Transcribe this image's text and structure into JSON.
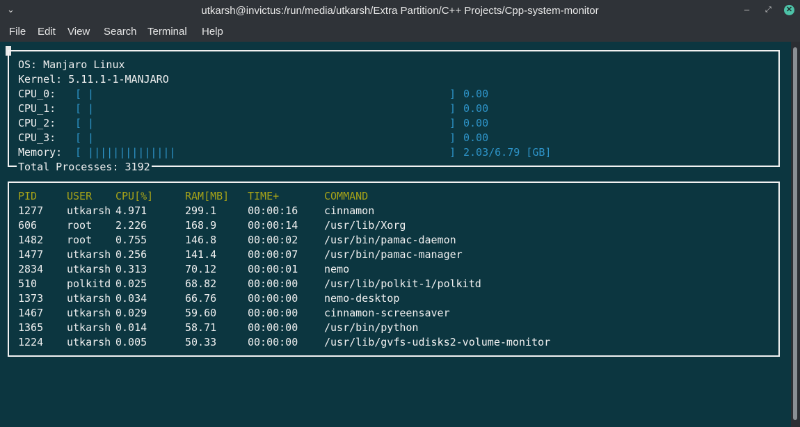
{
  "window": {
    "title": "utkarsh@invictus:/run/media/utkarsh/Extra Partition/C++ Projects/Cpp-system-monitor",
    "menu_icon": "chevron-down-icon",
    "controls": {
      "minimize": "minimize-icon",
      "maximize": "maximize-icon",
      "close": "close-icon"
    },
    "accent": "#4dc3a8"
  },
  "menu": [
    "File",
    "Edit",
    "View",
    "Search",
    "Terminal",
    "Help"
  ],
  "system": {
    "os_label": "OS: ",
    "os": "Manjaro Linux",
    "kernel_label": "Kernel: ",
    "kernel": "5.11.1-1-MANJARO",
    "cpus": [
      {
        "label": "CPU_0:",
        "bar": "[ |",
        "close": "]",
        "value": "0.00",
        "utilization": 0.0
      },
      {
        "label": "CPU_1:",
        "bar": "[ |",
        "close": "]",
        "value": "0.00",
        "utilization": 0.0
      },
      {
        "label": "CPU_2:",
        "bar": "[ |",
        "close": "]",
        "value": "0.00",
        "utilization": 0.0
      },
      {
        "label": "CPU_3:",
        "bar": "[ |",
        "close": "]",
        "value": "0.00",
        "utilization": 0.0
      }
    ],
    "memory": {
      "label": "Memory:",
      "bar": "[ ||||||||||||||",
      "close": "]",
      "value": "2.03/6.79 [GB]",
      "used_gb": 2.03,
      "total_gb": 6.79
    },
    "total_processes_label": "Total Processes: ",
    "total_processes": "3192"
  },
  "processes": {
    "headers": [
      "PID",
      "USER",
      "CPU[%]",
      "RAM[MB]",
      "TIME+",
      "COMMAND"
    ],
    "rows": [
      [
        "1277",
        "utkarsh",
        "4.971",
        "299.1",
        "00:00:16",
        "cinnamon"
      ],
      [
        "606",
        "root",
        "2.226",
        "168.9",
        "00:00:14",
        "/usr/lib/Xorg"
      ],
      [
        "1482",
        "root",
        "0.755",
        "146.8",
        "00:00:02",
        "/usr/bin/pamac-daemon"
      ],
      [
        "1477",
        "utkarsh",
        "0.256",
        "141.4",
        "00:00:07",
        "/usr/bin/pamac-manager"
      ],
      [
        "2834",
        "utkarsh",
        "0.313",
        "70.12",
        "00:00:01",
        "nemo"
      ],
      [
        "510",
        "polkitd",
        "0.025",
        "68.82",
        "00:00:00",
        "/usr/lib/polkit-1/polkitd"
      ],
      [
        "1373",
        "utkarsh",
        "0.034",
        "66.76",
        "00:00:00",
        "nemo-desktop"
      ],
      [
        "1467",
        "utkarsh",
        "0.029",
        "59.60",
        "00:00:00",
        "cinnamon-screensaver"
      ],
      [
        "1365",
        "utkarsh",
        "0.014",
        "58.71",
        "00:00:00",
        "/usr/bin/python"
      ],
      [
        "1224",
        "utkarsh",
        "0.005",
        "50.33",
        "00:00:00",
        "/usr/lib/gvfs-udisks2-volume-monitor"
      ]
    ]
  },
  "colors": {
    "terminal_bg": "#0c3640",
    "text": "#f0f0f0",
    "bars": "#2e94c9",
    "headers": "#a7a318"
  }
}
